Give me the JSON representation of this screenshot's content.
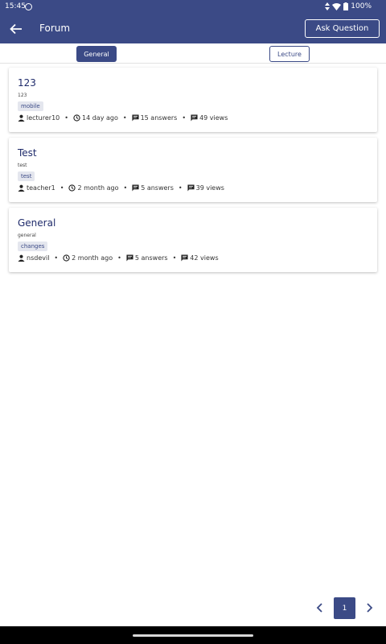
{
  "status_bar": {
    "time": "15:45",
    "battery": "100%"
  },
  "app_bar": {
    "title": "Forum",
    "ask_label": "Ask Question"
  },
  "tabs": [
    {
      "label": "General",
      "active": true
    },
    {
      "label": "Lecture",
      "active": false
    }
  ],
  "questions": [
    {
      "title": "123",
      "subtitle": "123",
      "tag": "mobile",
      "author": "lecturer10",
      "time": "14 day ago",
      "answers": "15 answers",
      "views": "49 views"
    },
    {
      "title": "Test",
      "subtitle": "test",
      "tag": "test",
      "author": "teacher1",
      "time": "2 month ago",
      "answers": "5 answers",
      "views": "39 views"
    },
    {
      "title": "General",
      "subtitle": "general",
      "tag": "changes",
      "author": "nsdevil",
      "time": "2 month ago",
      "answers": "5 answers",
      "views": "42 views"
    }
  ],
  "pagination": {
    "current_page": "1"
  },
  "colors": {
    "primary": "#3b4a86",
    "title_text": "#1f2b6b",
    "tag_bg": "#e4e6ee"
  }
}
